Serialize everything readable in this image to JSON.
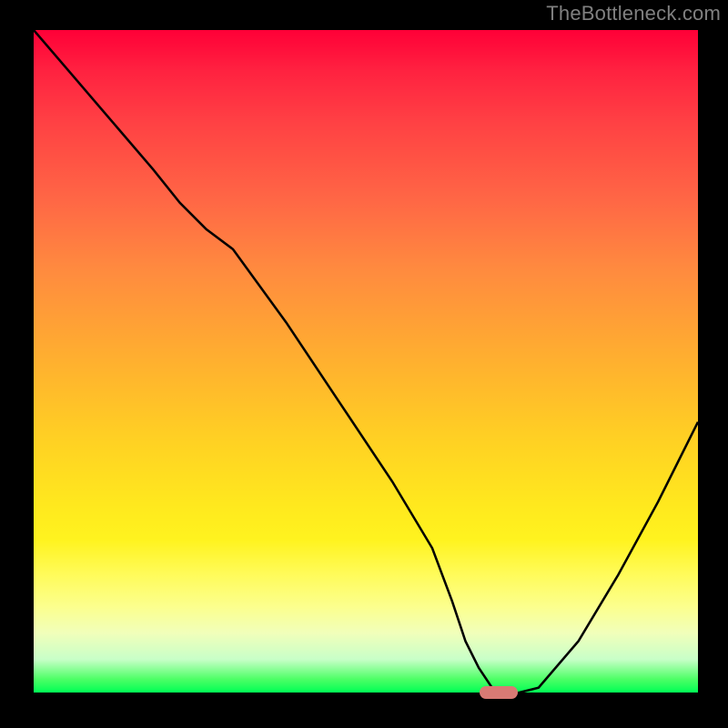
{
  "watermark": "TheBottleneck.com",
  "chart_data": {
    "type": "line",
    "title": "",
    "xlabel": "",
    "ylabel": "",
    "xlim": [
      0,
      100
    ],
    "ylim": [
      0,
      100
    ],
    "grid": false,
    "series": [
      {
        "name": "bottleneck-curve",
        "x": [
          0,
          6,
          12,
          18,
          22,
          26,
          30,
          38,
          46,
          54,
          60,
          63,
          65,
          67,
          69,
          72,
          76,
          82,
          88,
          94,
          100
        ],
        "y": [
          100,
          93,
          86,
          79,
          74,
          70,
          67,
          56,
          44,
          32,
          22,
          14,
          8,
          4,
          1,
          0,
          1,
          8,
          18,
          29,
          41
        ]
      }
    ],
    "marker": {
      "x": 70,
      "y": 0,
      "color": "#d97a74"
    },
    "background": "red-yellow-green vertical gradient"
  }
}
